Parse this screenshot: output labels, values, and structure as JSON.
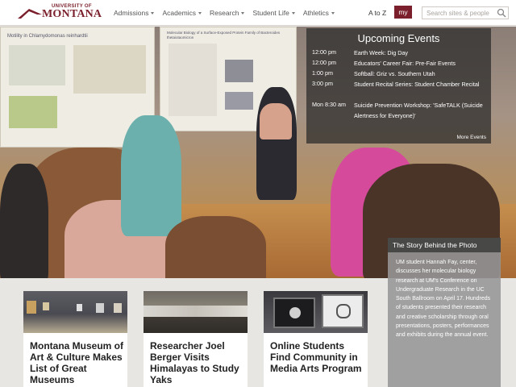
{
  "header": {
    "logo": {
      "line1": "UNIVERSITY OF",
      "line2": "MONTANA"
    },
    "nav": [
      {
        "label": "Admissions"
      },
      {
        "label": "Academics"
      },
      {
        "label": "Research"
      },
      {
        "label": "Student Life"
      },
      {
        "label": "Athletics"
      }
    ],
    "atoz": "A to Z",
    "my": "my",
    "search_placeholder": "Search sites & people"
  },
  "hero": {
    "poster_title": "Motility in Chlamydomonas reinhardtii",
    "poster2_title": "Molecular Biology of a Surface-Exposed Protein Family of Bacteroides thetaiotaomicron"
  },
  "events": {
    "title": "Upcoming Events",
    "items": [
      {
        "time": "12:00 pm",
        "name": "Earth Week: Dig Day"
      },
      {
        "time": "12:00 pm",
        "name": "Educators' Career Fair: Pre-Fair Events"
      },
      {
        "time": "1:00 pm",
        "name": "Softball: Griz vs. Southern Utah"
      },
      {
        "time": "3:00 pm",
        "name": "Student Recital Series: Student Chamber Recital"
      },
      {
        "time": "Mon 8:30 am",
        "name": "Suicide Prevention Workshop: 'SafeTALK (Suicide Alertness for Everyone)'"
      }
    ],
    "more": "More Events"
  },
  "story": {
    "title": "The Story Behind the Photo",
    "text": "UM student Hannah Fay, center, discusses her molecular biology research at UM's Conference on Undergraduate Research in the UC South Ballroom on April 17. Hundreds of students presented their research and creative scholarship through oral presentations, posters, performances and exhibits during the annual event."
  },
  "cards": [
    {
      "title": "Montana Museum of Art & Culture Makes List of Great Museums"
    },
    {
      "title": "Researcher Joel Berger Visits Himalayas to Study Yaks"
    },
    {
      "title": "Online Students Find Community in Media Arts Program"
    }
  ],
  "colors": {
    "brand": "#7a1f2b"
  }
}
